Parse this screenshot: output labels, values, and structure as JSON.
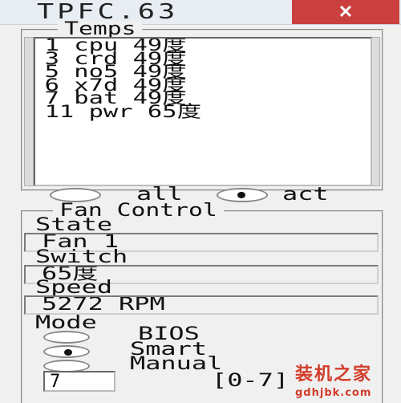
{
  "window": {
    "title": "TPFC.63",
    "close_glyph": "✕"
  },
  "temps": {
    "legend": "Temps",
    "lines": [
      "1 cpu 49度",
      "3 crd 49度",
      "5 no5 49度",
      "6 x7d 49度",
      "7 bat 49度",
      "11 pwr 65度"
    ]
  },
  "filter": {
    "all_label": "all",
    "act_label": "act",
    "selected": "act"
  },
  "fan_control": {
    "legend": "Fan Control",
    "state_label": "State",
    "state_value": "Fan 1",
    "switch_label": "Switch",
    "switch_value": "65度",
    "speed_label": "Speed",
    "speed_value": "5272 RPM"
  },
  "mode": {
    "label": "Mode",
    "options": [
      "BIOS",
      "Smart",
      "Manual"
    ],
    "selected": "Smart",
    "manual_value": "7",
    "range_label": "[0-7]"
  },
  "watermark": {
    "line1": "装机之家",
    "line2": "gdhjbk.com"
  },
  "colors": {
    "close_bg": "#c9403f",
    "watermark": "#d23c2a"
  }
}
